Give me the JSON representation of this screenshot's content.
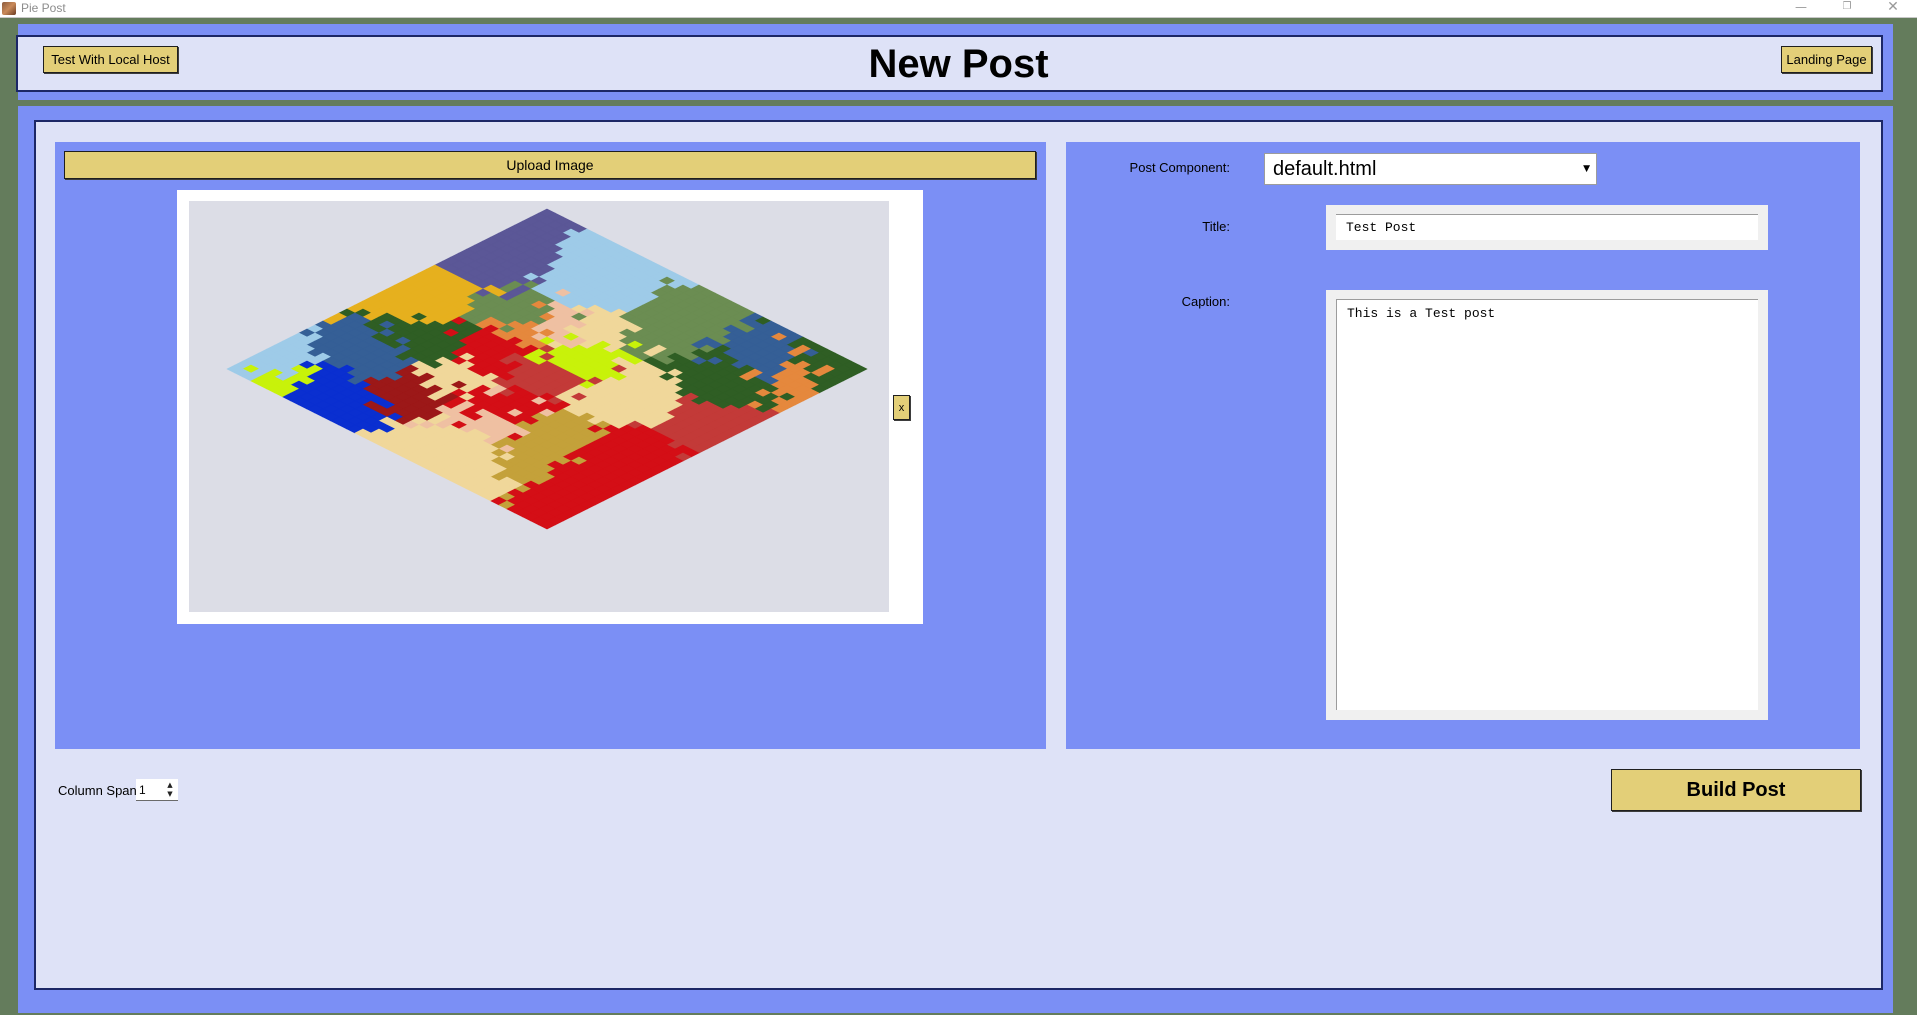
{
  "window": {
    "title": "Pie Post",
    "controls": {
      "minimize": "—",
      "maximize": "❐",
      "close": "✕"
    }
  },
  "header": {
    "title": "New Post",
    "local_host_button": "Test With Local Host",
    "landing_page_button": "Landing Page"
  },
  "image_panel": {
    "upload_button": "Upload Image",
    "remove_button": "x"
  },
  "form": {
    "component_label": "Post Component:",
    "component_value": "default.html",
    "component_arrow": "▼",
    "title_label": "Title:",
    "title_value": "Test Post",
    "caption_label": "Caption:",
    "caption_value": "This is a Test post"
  },
  "footer": {
    "column_span_label": "Column Span:",
    "column_span_value": "1",
    "spinner_up": "▲",
    "spinner_down": "▼",
    "build_button": "Build Post"
  },
  "colors": {
    "panel_blue": "#7b8ff5",
    "panel_light": "#dee2f7",
    "button_yellow": "#e3cf78",
    "background_green": "#647c5c"
  },
  "map_palette": [
    "#c4a13a",
    "#d1a83f",
    "#e6b01e",
    "#c8f20a",
    "#a7d36a",
    "#9ecbe8",
    "#2f5e24",
    "#6b8d52",
    "#0a2fd0",
    "#355f96",
    "#5b5797",
    "#d40e16",
    "#c33a38",
    "#9c1818",
    "#e5883d",
    "#efc0a2",
    "#f0d79a",
    "#d4a04e"
  ]
}
